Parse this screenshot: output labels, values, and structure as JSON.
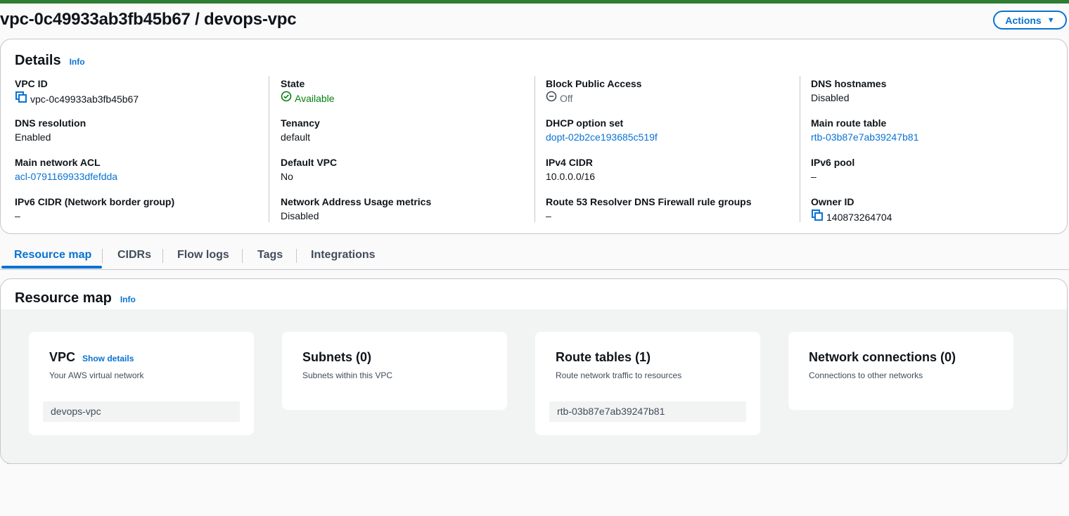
{
  "page": {
    "title": "vpc-0c49933ab3fb45b67 / devops-vpc",
    "actions_label": "Actions",
    "accent_color": "#0972d3",
    "top_bar_color": "#2e7d32"
  },
  "details": {
    "title": "Details",
    "info": "Info",
    "columns": [
      [
        {
          "label": "VPC ID",
          "value": "vpc-0c49933ab3fb45b67",
          "icon": "copy-icon"
        },
        {
          "label": "DNS resolution",
          "value": "Enabled"
        },
        {
          "label": "Main network ACL",
          "value": "acl-0791169933dfefdda",
          "link": true
        },
        {
          "label": "IPv6 CIDR (Network border group)",
          "value": "–"
        }
      ],
      [
        {
          "label": "State",
          "value": "Available",
          "icon": "check-circle-icon"
        },
        {
          "label": "Tenancy",
          "value": "default"
        },
        {
          "label": "Default VPC",
          "value": "No"
        },
        {
          "label": "Network Address Usage metrics",
          "value": "Disabled"
        }
      ],
      [
        {
          "label": "Block Public Access",
          "value": "Off",
          "icon": "minus-circle-icon"
        },
        {
          "label": "DHCP option set",
          "value": "dopt-02b2ce193685c519f",
          "link": true
        },
        {
          "label": "IPv4 CIDR",
          "value": "10.0.0.0/16"
        },
        {
          "label": "Route 53 Resolver DNS Firewall rule groups",
          "value": "–"
        }
      ],
      [
        {
          "label": "DNS hostnames",
          "value": "Disabled"
        },
        {
          "label": "Main route table",
          "value": "rtb-03b87e7ab39247b81",
          "link": true
        },
        {
          "label": "IPv6 pool",
          "value": "–"
        },
        {
          "label": "Owner ID",
          "value": "140873264704",
          "icon": "copy-icon"
        }
      ]
    ]
  },
  "tabs": [
    "Resource map",
    "CIDRs",
    "Flow logs",
    "Tags",
    "Integrations"
  ],
  "active_tab": "Resource map",
  "resource_map": {
    "title": "Resource map",
    "info": "Info",
    "nodes": [
      {
        "title": "VPC",
        "link": "Show details",
        "subtitle": "Your AWS virtual network",
        "items": [
          "devops-vpc"
        ]
      },
      {
        "title": "Subnets (0)",
        "subtitle": "Subnets within this VPC",
        "items": []
      },
      {
        "title": "Route tables (1)",
        "subtitle": "Route network traffic to resources",
        "items": [
          "rtb-03b87e7ab39247b81"
        ]
      },
      {
        "title": "Network connections (0)",
        "subtitle": "Connections to other networks",
        "items": []
      }
    ]
  }
}
